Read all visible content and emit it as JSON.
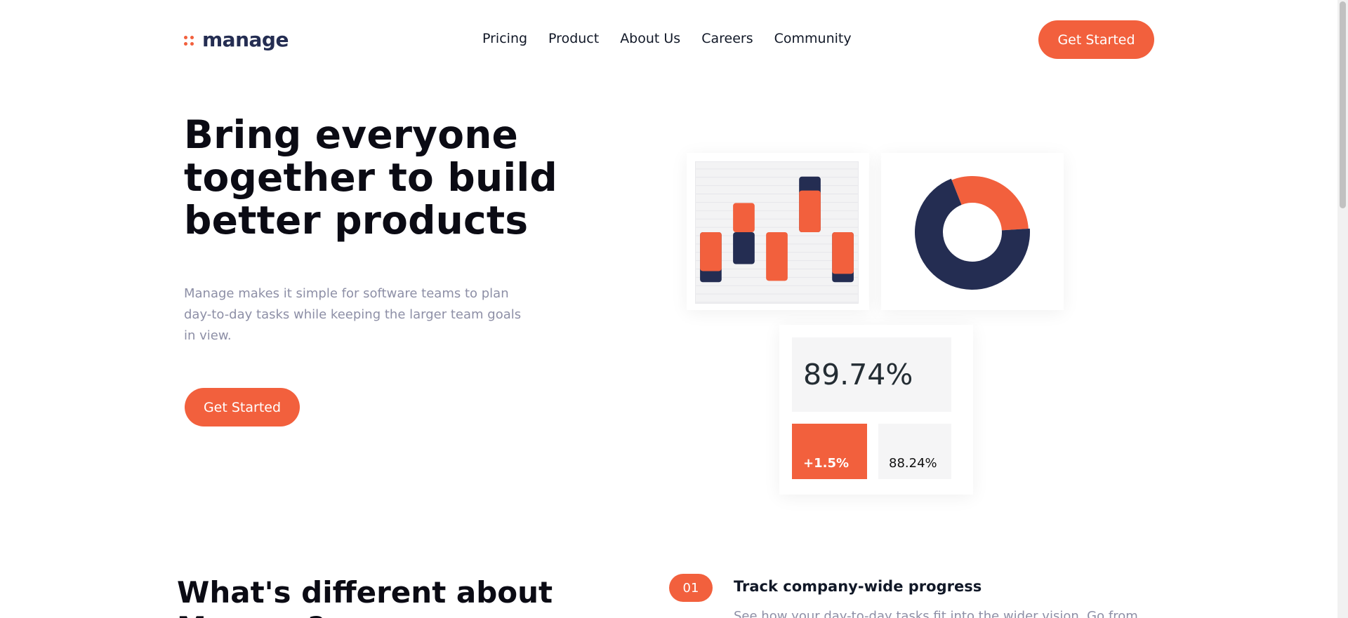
{
  "brand": {
    "name": "manage",
    "accent": "#f2603d",
    "dark": "#242d52"
  },
  "nav": {
    "items": [
      {
        "label": "Pricing"
      },
      {
        "label": "Product"
      },
      {
        "label": "About Us"
      },
      {
        "label": "Careers"
      },
      {
        "label": "Community"
      }
    ],
    "cta_label": "Get Started"
  },
  "hero": {
    "title": "Bring everyone together to build better products",
    "subtitle": "Manage makes it simple for software teams to plan day-to-day tasks while keeping the larger team goals in view.",
    "cta_label": "Get Started"
  },
  "chart_data": [
    {
      "type": "bar",
      "title": "",
      "categories": [
        "",
        "",
        "",
        "",
        ""
      ],
      "series": [
        {
          "values": [
            -2.8,
            2.1,
            -3.5,
            3.0,
            -3.0
          ],
          "color": "#f2603d"
        },
        {
          "values": [
            -3.6,
            -2.3,
            0,
            4.0,
            -3.6
          ],
          "color": "#242d52"
        }
      ]
    },
    {
      "type": "pie",
      "title": "",
      "series": [
        {
          "values": [
            0.3,
            0.7
          ],
          "colors": [
            "#f2603d",
            "#242d52"
          ]
        }
      ]
    }
  ],
  "stats": {
    "main_value": "89.74%",
    "change_value": "+1.5%",
    "secondary_value": "88.24%"
  },
  "features": {
    "heading": "What's different about Manage?",
    "first": {
      "number": "01",
      "title": "Track company-wide progress",
      "description": "See how your day-to-day tasks fit into the wider vision. Go from"
    }
  },
  "icons": {
    "logo": "manage-dots-icon"
  }
}
